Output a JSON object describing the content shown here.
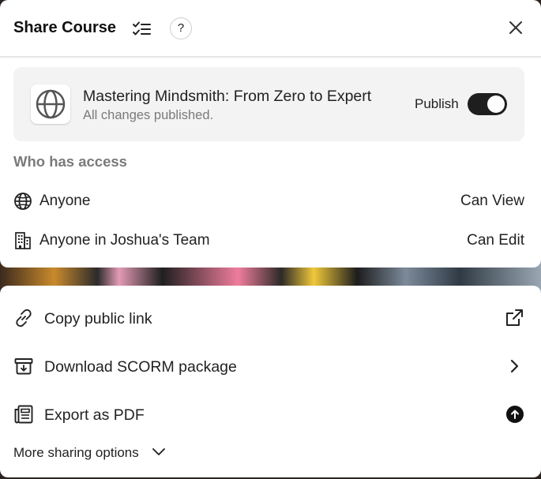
{
  "dialog": {
    "title": "Share Course",
    "help_label": "?"
  },
  "course": {
    "name": "Mastering Mindsmith: From Zero to Expert",
    "status": "All changes published.",
    "publish_label": "Publish",
    "publish_on": true
  },
  "access": {
    "section_title": "Who has access",
    "rows": [
      {
        "label": "Anyone",
        "permission": "Can View",
        "icon": "globe-icon"
      },
      {
        "label": "Anyone in Joshua's Team",
        "permission": "Can Edit",
        "icon": "building-icon"
      }
    ]
  },
  "actions": [
    {
      "label": "Copy public link",
      "icon": "link-icon",
      "trailing_icon": "external-link-icon"
    },
    {
      "label": "Download SCORM package",
      "icon": "archive-download-icon",
      "trailing_icon": "chevron-right-icon"
    },
    {
      "label": "Export as PDF",
      "icon": "document-icon",
      "trailing_icon": "upload-circle-icon"
    }
  ],
  "more_options_label": "More sharing options",
  "colors": {
    "toggle_on": "#1e1e1e",
    "muted_text": "#7a7a7a",
    "panel_bg": "#f3f3f3"
  }
}
